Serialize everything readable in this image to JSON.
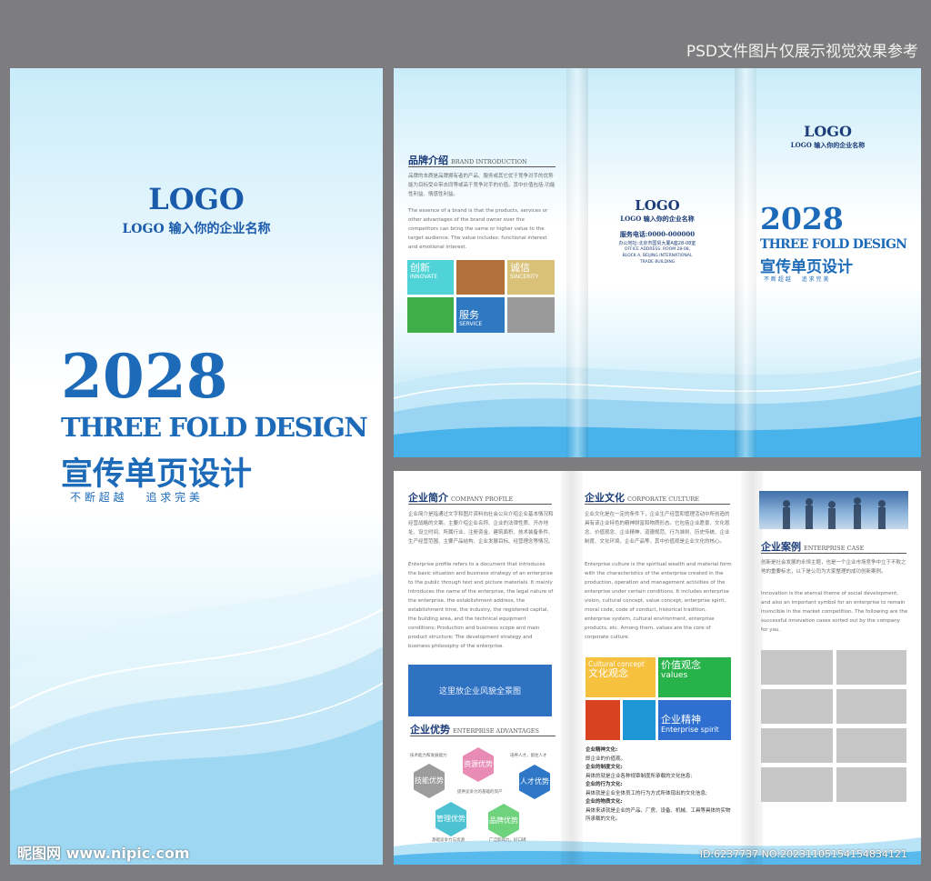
{
  "banner": "PSD文件图片仅展示视觉效果参考",
  "watermark": {
    "site": "昵图网 www.nipic.com",
    "id_line": "ID:6237737 NO:20231105154154834121"
  },
  "cover": {
    "logo": "LOGO",
    "company": "LOGO 输入你的企业名称",
    "year": "2028",
    "title_en": "THREE FOLD DESIGN",
    "title_cn": "宣传单页设计",
    "slogan": "不 断 超 越　　追 求 完 美"
  },
  "outside": {
    "brand": {
      "title": "品牌介绍",
      "title_en": "BRAND INTRODUCTION",
      "text_cn": "品牌的本质是品牌拥有者的产品、服务或其它优于竞争对手的优势能为目标受众带去同等或高于竞争对手的价值。其中价值包括:功能性利益、情感性利益。",
      "text_en": "The essence of a brand is that the products, services or other advantages of the brand owner over the competitors can bring the same or higher value to the target audience. The value includes: functional interest and emotional interest.",
      "tiles": [
        {
          "cn": "创新",
          "en": "INNOVATE",
          "color": "#4fd3d6"
        },
        {
          "cn": "",
          "en": "",
          "color": "#b2713a"
        },
        {
          "cn": "诚信",
          "en": "SINCERITY",
          "color": "#d9c17a"
        },
        {
          "cn": "",
          "en": "",
          "color": "#3fae49"
        },
        {
          "cn": "服务",
          "en": "SERVICE",
          "color": "#2f78c2"
        },
        {
          "cn": "",
          "en": "",
          "color": "#9a9a9a"
        }
      ]
    },
    "back": {
      "logo": "LOGO",
      "company": "LOGO 输入你的企业名称",
      "phone": "服务电话:0000-000000",
      "address": "办公地址:北京市国贸大厦A座28-08室",
      "address_en1": "OFFICE ADDRESS: ROOM 28-08,",
      "address_en2": "BLOCK A, BEIJING INTERNATIONAL",
      "address_en3": "TRADE BUILDING"
    },
    "front": {
      "logo": "LOGO",
      "company": "LOGO 输入你的企业名称",
      "year": "2028",
      "title_en": "THREE FOLD DESIGN",
      "title_cn": "宣传单页设计",
      "slogan": "不 断 超 越　　追 求 完 美"
    }
  },
  "inside": {
    "profile": {
      "title": "企业简介",
      "title_en": "COMPANY PROFILE",
      "text_cn": "企业简介是指通过文字和图片资料向社会公众介绍企业基本情况和经营战略的文案。主要介绍企业名称、企业的法律性质、开办地址、设立时间、所属行业、注册资金、建筑面积、技术装备条件、生产经营范围、主要产品结构、企业发展目标、经营理念等情况。",
      "text_en": "Enterprise profile refers to a document that introduces the basic situation and business strategy of an enterprise to the public through text and picture materials. It mainly introduces the name of the enterprise, the legal nature of the enterprise, the establishment address, the establishment time, the industry, the registered capital, the building area, and the technical equipment conditions; Production and business scope and main product structure; The development strategy and business philosophy of the enterprise.",
      "photo_placeholder": "这里放企业风貌全景图"
    },
    "advantages": {
      "title": "企业优势",
      "title_en": "ENTERPRISE ADVANTAGES",
      "notes": [
        "技术能力和发展能力",
        "培养人才，留住人才",
        "提供竞争力的基础的资产",
        "基础竞争力与资源",
        "广泛影响力，好口碑"
      ],
      "hexes": [
        {
          "label": "技能优势",
          "color": "#9c9c9c"
        },
        {
          "label": "资源优势",
          "color": "#e88bb5"
        },
        {
          "label": "人才优势",
          "color": "#2f78c8"
        },
        {
          "label": "管理优势",
          "color": "#4cc2d3"
        },
        {
          "label": "品牌优势",
          "color": "#6fd27d"
        }
      ]
    },
    "culture": {
      "title": "企业文化",
      "title_en": "CORPORATE CULTURE",
      "text_cn": "企业文化是在一定的条件下，企业生产经营和管理活动中所创造的具有该企业特色的精神财富和物质形态。它包括企业愿景、文化观念、价值观念、企业精神、道德规范、行为准则、历史传统、企业制度、文化环境、企业产品等，其中价值观是企业文化的核心。",
      "text_en": "Enterprise culture is the spiritual wealth and material form with the characteristics of the enterprise created in the production, operation and management activities of the enterprise under certain conditions. It includes enterprise vision, cultural concept, value concept, enterprise spirit, moral code, code of conduct, historical tradition, enterprise system, cultural environment, enterprise products, etc. Among them, values are the core of corporate culture.",
      "tiles": [
        {
          "cn": "文化观念",
          "en": "Cultural concept",
          "color": "#f5c13f"
        },
        {
          "cn": "价值观念",
          "en": "values",
          "color": "#27b24a"
        },
        {
          "cn": "",
          "en": "",
          "color": "#d9421e"
        },
        {
          "cn": "",
          "en": "",
          "color": "#1f96d6"
        },
        {
          "cn": "企业精神",
          "en": "Enterprise spirit",
          "color": "#2f6fd0"
        }
      ],
      "items": [
        {
          "head": "企业精神文化:",
          "body": "即企业的价值观。"
        },
        {
          "head": "企业的制度文化:",
          "body": "具体的就是企业各种规章制度所承载的文化信息;"
        },
        {
          "head": "企业的行为文化:",
          "body": "具体就是企业全体员工的行为方式所体现出的文化信息;"
        },
        {
          "head": "企业的物质文化:",
          "body": "具体来讲就是企业的产品、厂房、设备、机械、工具等具体的实物所承载的文化。"
        }
      ]
    },
    "cases": {
      "title": "企业案例",
      "title_en": "ENTERPRISE CASE",
      "text_cn": "创新是社会发展的永恒主题，也是一个企业市场竞争中立于不败之地的重要标志，以下是公司为大家整理的成功创新案例。",
      "text_en": "Innovation is the eternal theme of social development, and also an important symbol for an enterprise to remain invincible in the market competition. The following are the successful innovation cases sorted out by the company for you."
    }
  }
}
